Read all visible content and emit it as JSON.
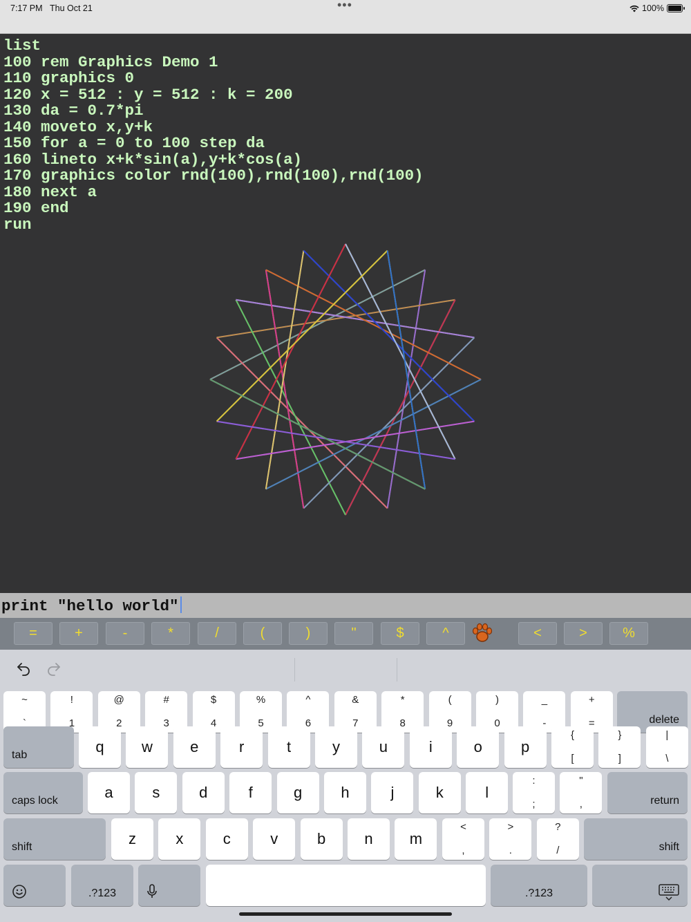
{
  "status": {
    "time": "7:17 PM",
    "date": "Thu Oct 21",
    "dots": "•••",
    "battery": "100%"
  },
  "terminal": {
    "lines": [
      "list",
      "100 rem Graphics Demo 1",
      "110 graphics 0",
      "120 x = 512 : y = 512 : k = 200",
      "130 da = 0.7*pi",
      "140 moveto x,y+k",
      "150 for a = 0 to 100 step da",
      "160 lineto x+k*sin(a),y+k*cos(a)",
      "170 graphics color rnd(100),rnd(100),rnd(100)",
      "180 next a",
      "190 end",
      "run"
    ]
  },
  "input": {
    "text": "print \"hello world\""
  },
  "accessory_keys": [
    "=",
    "+",
    "-",
    "*",
    "/",
    "(",
    ")",
    "\"",
    "$",
    "^",
    "<",
    ">",
    "%"
  ],
  "colors": {
    "terminal_bg": "#333334",
    "code_text": "#c9f7bd",
    "accessory_text": "#f1dd2e"
  },
  "keyboard": {
    "row1": [
      {
        "top": "~",
        "bot": "`"
      },
      {
        "top": "!",
        "bot": "1"
      },
      {
        "top": "@",
        "bot": "2"
      },
      {
        "top": "#",
        "bot": "3"
      },
      {
        "top": "$",
        "bot": "4"
      },
      {
        "top": "%",
        "bot": "5"
      },
      {
        "top": "^",
        "bot": "6"
      },
      {
        "top": "&",
        "bot": "7"
      },
      {
        "top": "*",
        "bot": "8"
      },
      {
        "top": "(",
        "bot": "9"
      },
      {
        "top": ")",
        "bot": "0"
      },
      {
        "top": "_",
        "bot": "-"
      },
      {
        "top": "+",
        "bot": "="
      }
    ],
    "delete": "delete",
    "tab": "tab",
    "row2": [
      "q",
      "w",
      "e",
      "r",
      "t",
      "y",
      "u",
      "i",
      "o",
      "p"
    ],
    "row2_punct": [
      {
        "top": "{",
        "bot": "["
      },
      {
        "top": "}",
        "bot": "]"
      },
      {
        "top": "|",
        "bot": "\\"
      }
    ],
    "caps": "caps lock",
    "row3": [
      "a",
      "s",
      "d",
      "f",
      "g",
      "h",
      "j",
      "k",
      "l"
    ],
    "row3_punct": [
      {
        "top": ":",
        "bot": ";"
      },
      {
        "top": "\"",
        "bot": ","
      }
    ],
    "return": "return",
    "shift": "shift",
    "row4": [
      "z",
      "x",
      "c",
      "v",
      "b",
      "n",
      "m"
    ],
    "row4_punct": [
      {
        "top": "<",
        "bot": ","
      },
      {
        "top": ">",
        "bot": "."
      },
      {
        "top": "?",
        "bot": "/"
      }
    ],
    "num": ".?123",
    "icons": [
      "undo-icon",
      "redo-icon",
      "emoji-icon",
      "microphone-icon",
      "keyboard-dismiss-icon",
      "wifi-icon",
      "battery-icon",
      "paw-icon"
    ]
  }
}
